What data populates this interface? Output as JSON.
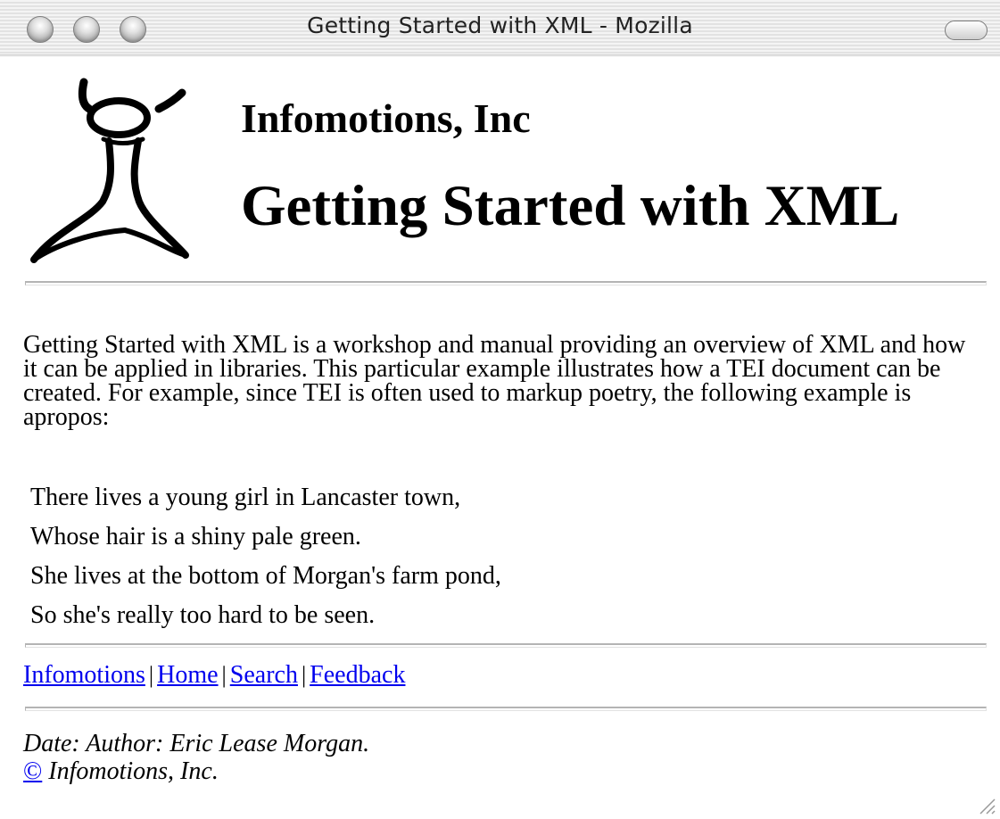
{
  "window": {
    "title": "Getting Started with XML - Mozilla"
  },
  "header": {
    "company": "Infomotions, Inc",
    "heading": "Getting Started with XML"
  },
  "intro": "Getting Started with XML is a workshop and manual providing an overview of XML and how it can be applied in libraries. This particular example illustrates how a TEI document can be created. For example, since TEI is often used to markup poetry, the following example is apropos:",
  "poem": [
    "There lives a young girl in Lancaster town,",
    "Whose hair is a shiny pale green.",
    "She lives at the bottom of Morgan's farm pond,",
    "So she's really too hard to be seen."
  ],
  "footer_nav": {
    "links": [
      "Infomotions",
      "Home",
      "Search",
      "Feedback"
    ],
    "separator": "|"
  },
  "meta": {
    "line1": "Date:  Author: Eric Lease Morgan.",
    "copyright_symbol": "©",
    "line2": " Infomotions, Inc."
  },
  "colors": {
    "link": "#0000ee",
    "rule": "#b4b4b4"
  },
  "icons": {
    "logo": "stick-figure-logo-icon",
    "resize": "resize-grip-icon"
  }
}
